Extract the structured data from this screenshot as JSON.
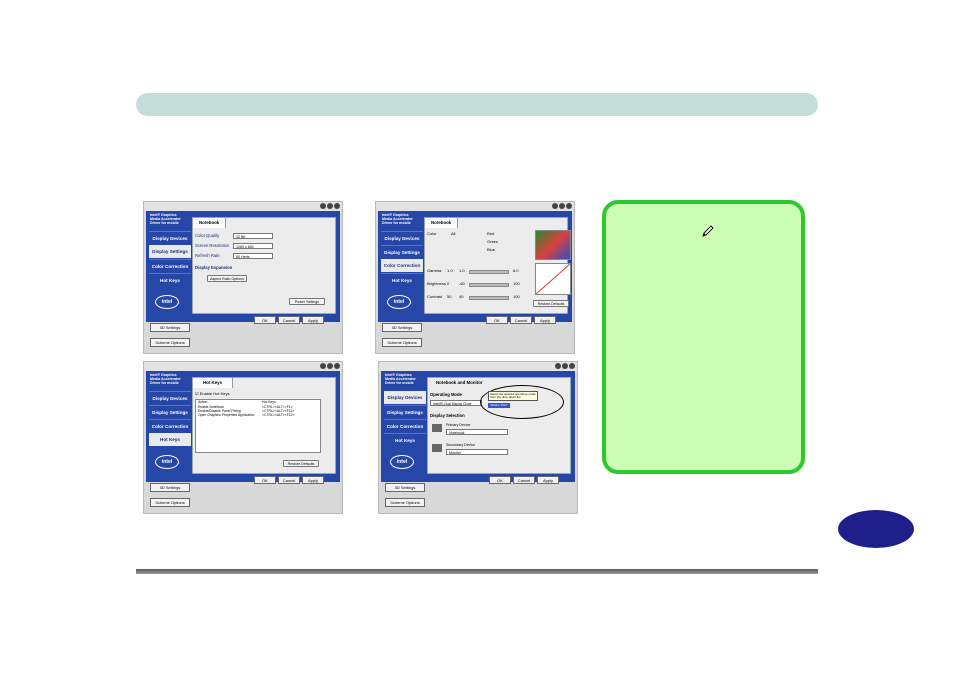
{
  "page": {
    "number": ""
  },
  "shots": {
    "brand": "Intel® Graphics Media Accelerator Driver for mobile",
    "nav": [
      "Display Devices",
      "Display Settings",
      "Color Correction",
      "Hot Keys"
    ],
    "intel_logo": "intel",
    "buttons": {
      "ok": "OK",
      "cancel": "Cancel",
      "apply": "Apply",
      "settings3d": "3D Settings",
      "schemes": "Scheme Options"
    },
    "s1": {
      "tab": "Notebook",
      "color_quality_label": "Color Quality",
      "color_quality_value": "32 Bit",
      "resolution_label": "Screen Resolution",
      "resolution_value": "1280 x 800",
      "refresh_label": "Refresh Rate",
      "refresh_value": "60 Hertz",
      "expansion_label": "Display Expansion",
      "aspect_button": "Aspect Ratio Options",
      "power_button": "Power Settings"
    },
    "s2": {
      "tab": "Notebook",
      "color_label": "Color",
      "all_label": "All",
      "red": "Red",
      "green": "Green",
      "blue": "Blue",
      "gamma_label": "Gamma",
      "gamma_value": "1.0",
      "gamma_min": "1.0",
      "gamma_max": "6.0",
      "brightness_label": "Brightness",
      "brightness_value": "0",
      "brightness_min": "-60",
      "brightness_max": "100",
      "contrast_label": "Contrast",
      "contrast_value": "50",
      "contrast_min": "40",
      "contrast_max": "100",
      "restore_button": "Restore Defaults"
    },
    "s3": {
      "tab": "Hot Keys",
      "enable_label": "Enable Hot Keys",
      "col_action": "Action",
      "col_hotkey": "Hot Keys",
      "rows": [
        {
          "action": "Enable Notebook",
          "key": "<CTRL><ALT><F1>"
        },
        {
          "action": "Enable/Disable Panel Fitting",
          "key": "<CTRL><ALT><F11>"
        },
        {
          "action": "Open Graphics Properties Application",
          "key": "<CTRL><ALT><F12>"
        }
      ],
      "restore_button": "Restore Defaults"
    },
    "s4": {
      "tab": "Notebook and Monitor",
      "operating_mode": "Operating Mode",
      "mode_value": "Intel(R) Dual Display Clone",
      "tooltip": "Select the desired operating mode from the drop-down list.",
      "whats_this": "What's This?",
      "display_selection": "Display Selection",
      "primary_label": "Primary Device",
      "primary_value": "Notebook",
      "secondary_label": "Secondary Device",
      "secondary_value": "Monitor"
    }
  }
}
